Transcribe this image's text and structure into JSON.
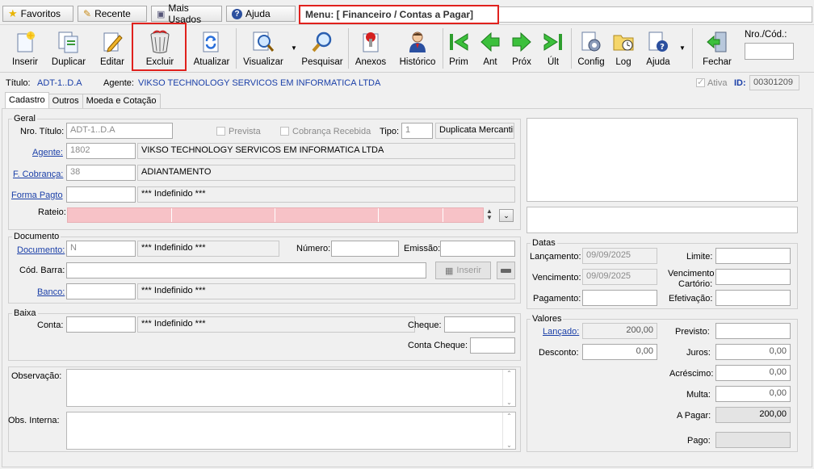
{
  "topbar": {
    "favoritos": "Favoritos",
    "recente": "Recente",
    "mais_usados": "Mais Usados",
    "ajuda": "Ajuda",
    "menu_path": "Menu: [ Financeiro / Contas a Pagar]"
  },
  "toolbar": {
    "inserir": "Inserir",
    "duplicar": "Duplicar",
    "editar": "Editar",
    "excluir": "Excluir",
    "atualizar": "Atualizar",
    "visualizar": "Visualizar",
    "pesquisar": "Pesquisar",
    "anexos": "Anexos",
    "historico": "Histórico",
    "prim": "Prim",
    "ant": "Ant",
    "prox": "Próx",
    "ult": "Últ",
    "config": "Config",
    "log": "Log",
    "ajuda": "Ajuda",
    "fechar": "Fechar",
    "nro_cod_label": "Nro./Cód.:"
  },
  "header": {
    "titulo_label": "Título:",
    "titulo_value": "ADT-1..D.A",
    "agente_label": "Agente:",
    "agente_value": "VIKSO TECHNOLOGY SERVICOS EM INFORMATICA LTDA",
    "ativa_label": "Ativa",
    "id_label": "ID:",
    "id_value": "00301209"
  },
  "tabs": [
    "Cadastro",
    "Outros",
    "Moeda e Cotação"
  ],
  "geral": {
    "title": "Geral",
    "nro_titulo_label": "Nro. Título:",
    "nro_titulo_value": "ADT-1..D.A",
    "prevista_label": "Prevista",
    "cobranca_recebida_label": "Cobrança Recebida",
    "tipo_label": "Tipo:",
    "tipo_code": "1",
    "tipo_desc": "Duplicata Mercantil",
    "agente_label": "Agente:",
    "agente_code": "1802",
    "agente_name": "VIKSO TECHNOLOGY SERVICOS EM INFORMATICA LTDA",
    "fcobranca_label": "F. Cobrança:",
    "fcobranca_code": "38",
    "fcobranca_desc": "ADIANTAMENTO",
    "forma_pagto_label": "Forma Pagto",
    "forma_pagto_code": "",
    "forma_pagto_desc": "*** Indefinido ***",
    "rateio_label": "Rateio:"
  },
  "documento": {
    "title": "Documento",
    "documento_label": "Documento:",
    "documento_code": "N",
    "documento_desc": "*** Indefinido ***",
    "numero_label": "Número:",
    "numero_value": "",
    "emissao_label": "Emissão:",
    "emissao_value": "",
    "cod_barra_label": "Cód. Barra:",
    "cod_barra_value": "",
    "inserir_btn": "Inserir",
    "banco_label": "Banco:",
    "banco_code": "",
    "banco_desc": "*** Indefinido ***"
  },
  "baixa": {
    "title": "Baixa",
    "conta_label": "Conta:",
    "conta_code": "",
    "conta_desc": "*** Indefinido ***",
    "cheque_label": "Cheque:",
    "cheque_value": "",
    "conta_cheque_label": "Conta Cheque:",
    "conta_cheque_value": ""
  },
  "obs": {
    "observacao_label": "Observação:",
    "obs_interna_label": "Obs. Interna:"
  },
  "datas": {
    "title": "Datas",
    "lancamento_label": "Lançamento:",
    "lancamento_value": "09/09/2025",
    "limite_label": "Limite:",
    "limite_value": "",
    "vencimento_label": "Vencimento:",
    "vencimento_value": "09/09/2025",
    "venc_cartorio_label1": "Vencimento",
    "venc_cartorio_label2": "Cartório:",
    "venc_cartorio_value": "",
    "pagamento_label": "Pagamento:",
    "pagamento_value": "",
    "efetivacao_label": "Efetivação:",
    "efetivacao_value": ""
  },
  "valores": {
    "title": "Valores",
    "lancado_label": "Lançado:",
    "lancado_value": "200,00",
    "previsto_label": "Previsto:",
    "previsto_value": "",
    "desconto_label": "Desconto:",
    "desconto_value": "0,00",
    "juros_label": "Juros:",
    "juros_value": "0,00",
    "acrescimo_label": "Acréscimo:",
    "acrescimo_value": "0,00",
    "multa_label": "Multa:",
    "multa_value": "0,00",
    "a_pagar_label": "A Pagar:",
    "a_pagar_value": "200,00",
    "pago_label": "Pago:",
    "pago_value": ""
  }
}
